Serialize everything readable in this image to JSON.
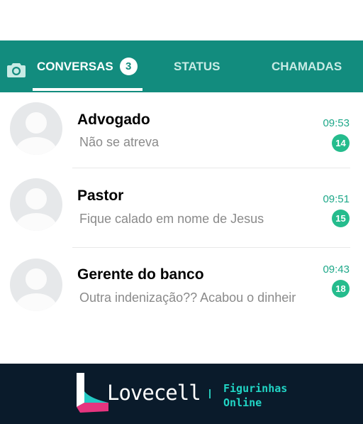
{
  "tabs": {
    "camera_icon": "camera-icon",
    "items": [
      {
        "label": "CONVERSAS",
        "badge": "3",
        "active": true
      },
      {
        "label": "STATUS"
      },
      {
        "label": "CHAMADAS"
      }
    ]
  },
  "chats": [
    {
      "name": "Advogado",
      "message": "Não se atreva",
      "time": "09:53",
      "unread": "14"
    },
    {
      "name": "Pastor",
      "message": "Fique calado em nome de Jesus",
      "time": "09:51",
      "unread": "15"
    },
    {
      "name": "Gerente do banco",
      "message": "Outra indenização?? Acabou o dinheir",
      "time": "09:43",
      "unread": "18"
    }
  ],
  "footer": {
    "brand": "Lovecell",
    "tagline_line1": "Figurinhas",
    "tagline_line2": "Online"
  },
  "colors": {
    "header": "#128c7e",
    "accent": "#25bc8d",
    "footer_bg": "#0a1b2b",
    "footer_text": "#21d4c4"
  }
}
